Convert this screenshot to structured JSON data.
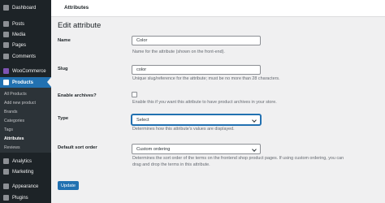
{
  "sidebar": {
    "items": [
      {
        "label": "Dashboard",
        "icon": "dashboard-icon"
      },
      {
        "label": "Posts",
        "icon": "pin-icon"
      },
      {
        "label": "Media",
        "icon": "media-icon"
      },
      {
        "label": "Pages",
        "icon": "pages-icon"
      },
      {
        "label": "Comments",
        "icon": "comment-icon"
      },
      {
        "label": "WooCommerce",
        "icon": "woocommerce-icon"
      },
      {
        "label": "Products",
        "icon": "products-icon"
      },
      {
        "label": "Analytics",
        "icon": "analytics-icon"
      },
      {
        "label": "Marketing",
        "icon": "megaphone-icon"
      },
      {
        "label": "Appearance",
        "icon": "brush-icon"
      },
      {
        "label": "Plugins",
        "icon": "plugin-icon"
      }
    ],
    "submenu": [
      "All Products",
      "Add new product",
      "Brands",
      "Categories",
      "Tags",
      "Attributes",
      "Reviews"
    ],
    "accent": "#2271b1"
  },
  "topbar": {
    "title": "Attributes"
  },
  "page": {
    "title": "Edit attribute"
  },
  "form": {
    "name": {
      "label": "Name",
      "value": "Color",
      "description": "Name for the attribute (shown on the front-end)."
    },
    "slug": {
      "label": "Slug",
      "value": "color",
      "description": "Unique slug/reference for the attribute; must be no more than 28 characters."
    },
    "archives": {
      "label": "Enable archives?",
      "description": "Enable this if you want this attribute to have product archives in your store."
    },
    "type": {
      "label": "Type",
      "value": "Select",
      "description": "Determines how this attribute's values are displayed."
    },
    "sort": {
      "label": "Default sort order",
      "value": "Custom ordering",
      "description_1": "Determines the sort order of the terms on the frontend shop product pages. If using custom ordering, you can",
      "description_2": "drag and drop the terms in this attribute."
    },
    "update_label": "Update"
  }
}
